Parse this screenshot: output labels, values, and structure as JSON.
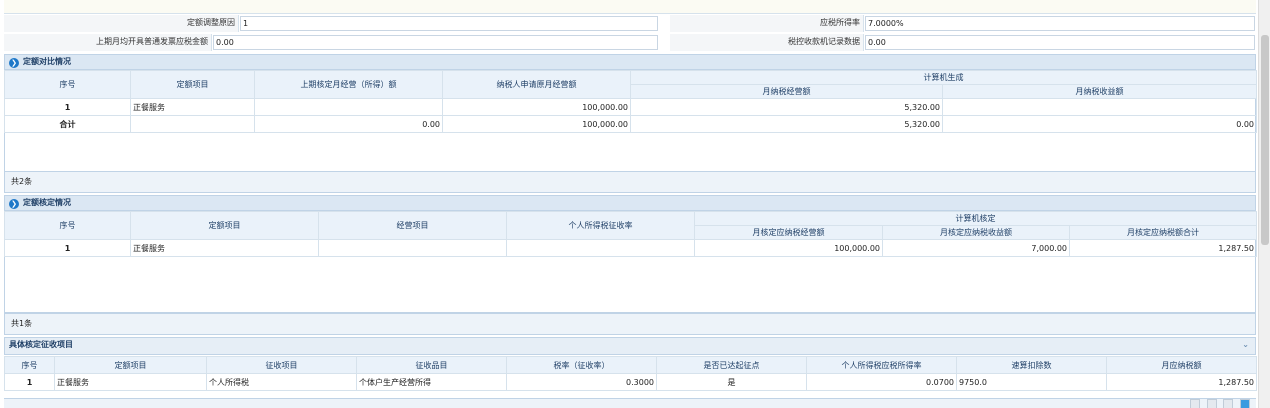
{
  "form": {
    "row1": {
      "label": "定额调整原因",
      "value": "1",
      "label2": "应税所得率",
      "value2": "7.0000%"
    },
    "row2": {
      "label": "上期月均开具普通发票应税金额",
      "value": "0.00",
      "label2": "税控收款机记录数据",
      "value2": "0.00"
    }
  },
  "comparison": {
    "title": "定额对比情况",
    "headers": {
      "seq": "序号",
      "item": "定额项目",
      "prev": "上期核定月经营（所得）额",
      "applied": "纳税人申请原月经营额",
      "computer": "计算机生成",
      "monthly_turnover": "月纳税经营额",
      "monthly_income": "月纳税收益额"
    },
    "rows": [
      {
        "seq": "1",
        "item": "正餐服务",
        "prev": "",
        "applied": "100,000.00",
        "turnover": "5,320.00",
        "income": ""
      },
      {
        "seq": "合计",
        "item": "",
        "prev": "0.00",
        "applied": "100,000.00",
        "turnover": "5,320.00",
        "income": "0.00"
      }
    ],
    "footer": "共2条"
  },
  "verification": {
    "title": "定额核定情况",
    "headers": {
      "seq": "序号",
      "item": "定额项目",
      "business": "经营项目",
      "rate": "个人所得税征收率",
      "computer": "计算机核定",
      "turnover": "月核定应纳税经营额",
      "income": "月核定应纳税收益额",
      "total": "月核定应纳税额合计"
    },
    "rows": [
      {
        "seq": "1",
        "item": "正餐服务",
        "business": "",
        "rate": "",
        "turnover": "100,000.00",
        "income": "7,000.00",
        "total": "1,287.50"
      }
    ],
    "footer": "共1条"
  },
  "levy": {
    "title": "具体核定征收项目",
    "headers": {
      "seq": "序号",
      "item": "定额项目",
      "levy_item": "征收项目",
      "levy_sub": "征收品目",
      "rate": "税率（征收率）",
      "threshold": "是否已达起征点",
      "pit_rate": "个人所得税应税所得率",
      "deduction": "速算扣除数",
      "monthly_tax": "月应纳税额"
    },
    "rows": [
      {
        "seq": "1",
        "item": "正餐服务",
        "levy_item": "个人所得税",
        "levy_sub": "个体户生产经营所得",
        "rate": "0.3000",
        "threshold": "是",
        "pit_rate": "0.0700",
        "deduction": "9750.0",
        "monthly_tax": "1,287.50"
      }
    ]
  }
}
